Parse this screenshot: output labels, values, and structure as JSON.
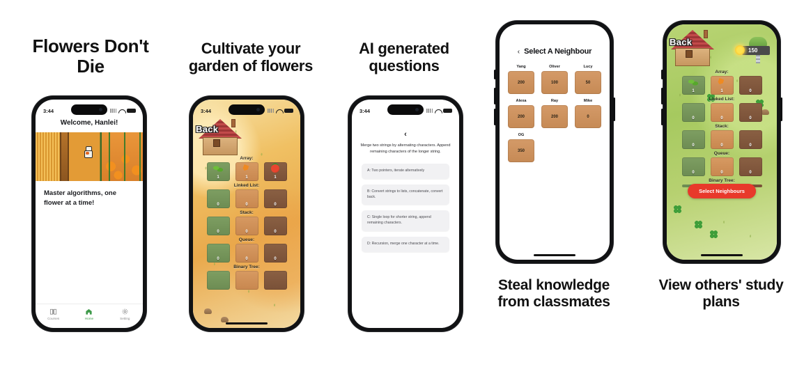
{
  "meta": {
    "status_time": "3:44"
  },
  "captions": {
    "one": "Flowers Don't Die",
    "two": "Cultivate your garden of flowers",
    "three": "AI generated questions",
    "four": "Steal knowledge from classmates",
    "five": "View others' study plans"
  },
  "phone1": {
    "welcome": "Welcome, Hanlei!",
    "tagline": "Master algorithms, one flower at a time!",
    "tabs": [
      {
        "label": "Courses",
        "icon": "book-icon",
        "active": false
      },
      {
        "label": "Home",
        "icon": "home-icon",
        "active": true
      },
      {
        "label": "Setting",
        "icon": "gear-icon",
        "active": false
      }
    ]
  },
  "phone2": {
    "back_label": "Back",
    "sections": [
      {
        "title": "Array:",
        "tiles": [
          {
            "count": "1",
            "crop": "crop-leaf"
          },
          {
            "count": "1",
            "crop": "crop-carrot"
          },
          {
            "count": "1",
            "crop": "crop-tomato"
          }
        ]
      },
      {
        "title": "Linked List:",
        "tiles": [
          {
            "count": "0",
            "crop": ""
          },
          {
            "count": "0",
            "crop": ""
          },
          {
            "count": "0",
            "crop": ""
          }
        ]
      },
      {
        "title": "Stack:",
        "tiles": [
          {
            "count": "0",
            "crop": ""
          },
          {
            "count": "0",
            "crop": ""
          },
          {
            "count": "0",
            "crop": ""
          }
        ]
      },
      {
        "title": "Queue:",
        "tiles": [
          {
            "count": "0",
            "crop": ""
          },
          {
            "count": "0",
            "crop": ""
          },
          {
            "count": "0",
            "crop": ""
          }
        ]
      },
      {
        "title": "Binary Tree:",
        "tiles": [
          {
            "count": "",
            "crop": ""
          },
          {
            "count": "",
            "crop": ""
          },
          {
            "count": "",
            "crop": ""
          }
        ]
      }
    ]
  },
  "phone3": {
    "back_chevron": "‹",
    "question": "Merge two strings by alternating characters. Append remaining characters of the longer string.",
    "options": [
      "A: Two pointers, iterate alternatively",
      "B: Convert strings to lists, concatenate, convert back.",
      "C: Single loop for shorter string, append remaining characters.",
      "D: Recursion, merge one character at a time."
    ]
  },
  "phone4": {
    "chevron": "‹",
    "title": "Select A Neighbour",
    "neighbours": [
      {
        "name": "Yang",
        "score": "200"
      },
      {
        "name": "Oliver",
        "score": "100"
      },
      {
        "name": "Lucy",
        "score": "50"
      },
      {
        "name": "Alexa",
        "score": "200"
      },
      {
        "name": "Ray",
        "score": "200"
      },
      {
        "name": "Mike",
        "score": "0"
      },
      {
        "name": "OG",
        "score": "350"
      }
    ]
  },
  "phone5": {
    "back_label": "Back",
    "coins": "150",
    "button_label": "Select Neighbours",
    "sections": [
      {
        "title": "Array:",
        "tiles": [
          {
            "count": "1",
            "crop": "crop-leaf"
          },
          {
            "count": "1",
            "crop": "crop-carrot"
          },
          {
            "count": "0",
            "crop": ""
          }
        ]
      },
      {
        "title": "Linked List:",
        "tiles": [
          {
            "count": "0",
            "crop": ""
          },
          {
            "count": "0",
            "crop": ""
          },
          {
            "count": "0",
            "crop": ""
          }
        ]
      },
      {
        "title": "Stack:",
        "tiles": [
          {
            "count": "0",
            "crop": ""
          },
          {
            "count": "0",
            "crop": ""
          },
          {
            "count": "0",
            "crop": ""
          }
        ]
      },
      {
        "title": "Queue:",
        "tiles": [
          {
            "count": "0",
            "crop": ""
          },
          {
            "count": "0",
            "crop": ""
          },
          {
            "count": "0",
            "crop": ""
          }
        ]
      },
      {
        "title": "Binary Tree:",
        "tiles": []
      }
    ]
  },
  "colors": {
    "accent_red": "#e8392b",
    "tab_active": "#3f9a4a",
    "tile_green": "#6d8c53",
    "tile_orange": "#c8874f",
    "tile_brown": "#7a5138"
  }
}
